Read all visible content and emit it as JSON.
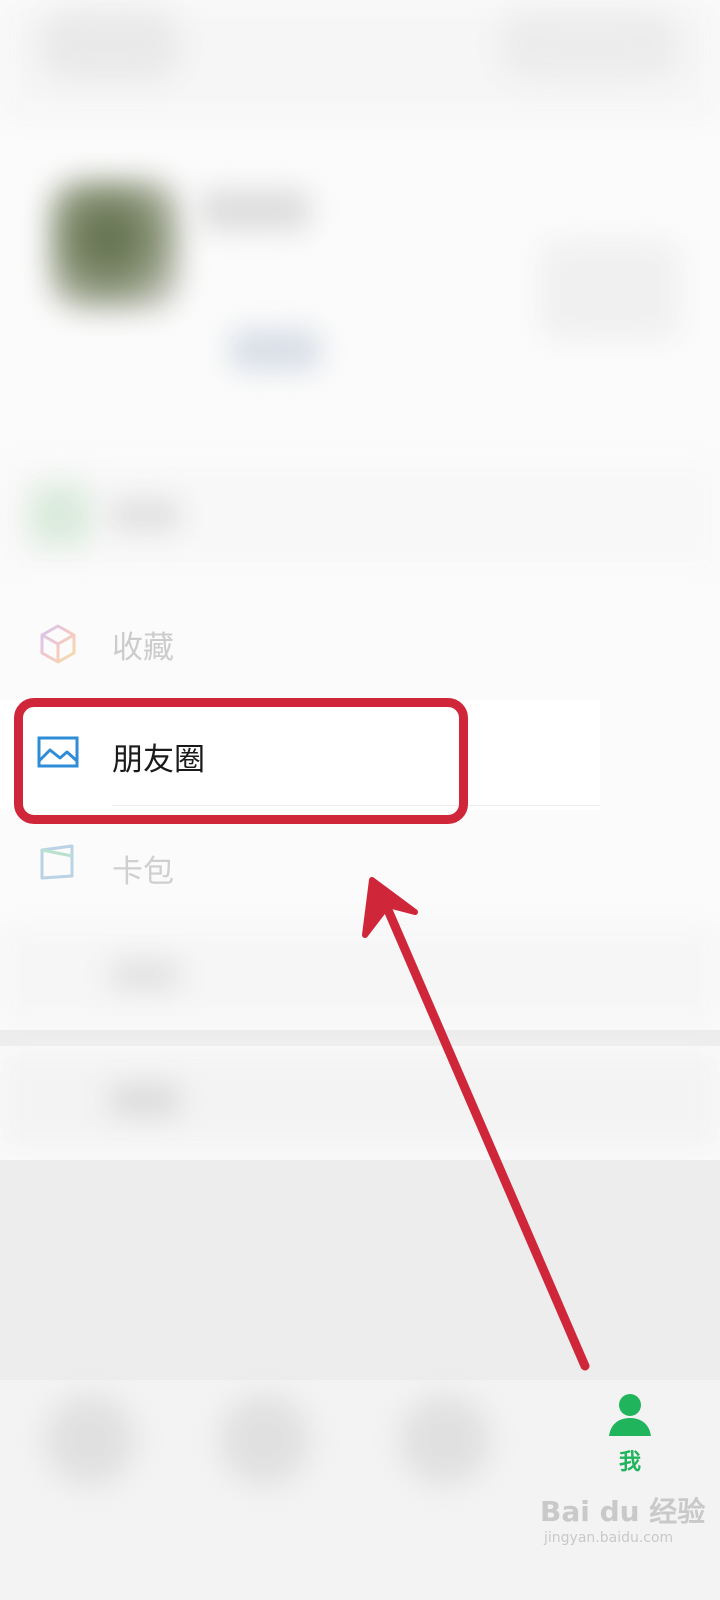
{
  "menu": {
    "favorites_label": "收藏",
    "moments_label": "朋友圈",
    "cards_label": "卡包"
  },
  "tabbar": {
    "me_label": "我",
    "active_color": "#20b55c"
  },
  "annotation": {
    "highlight_color": "#d0263a",
    "arrow_color": "#d0263a"
  },
  "watermark": {
    "brand": "Bai du 经验",
    "url": "jingyan.baidu.com"
  }
}
